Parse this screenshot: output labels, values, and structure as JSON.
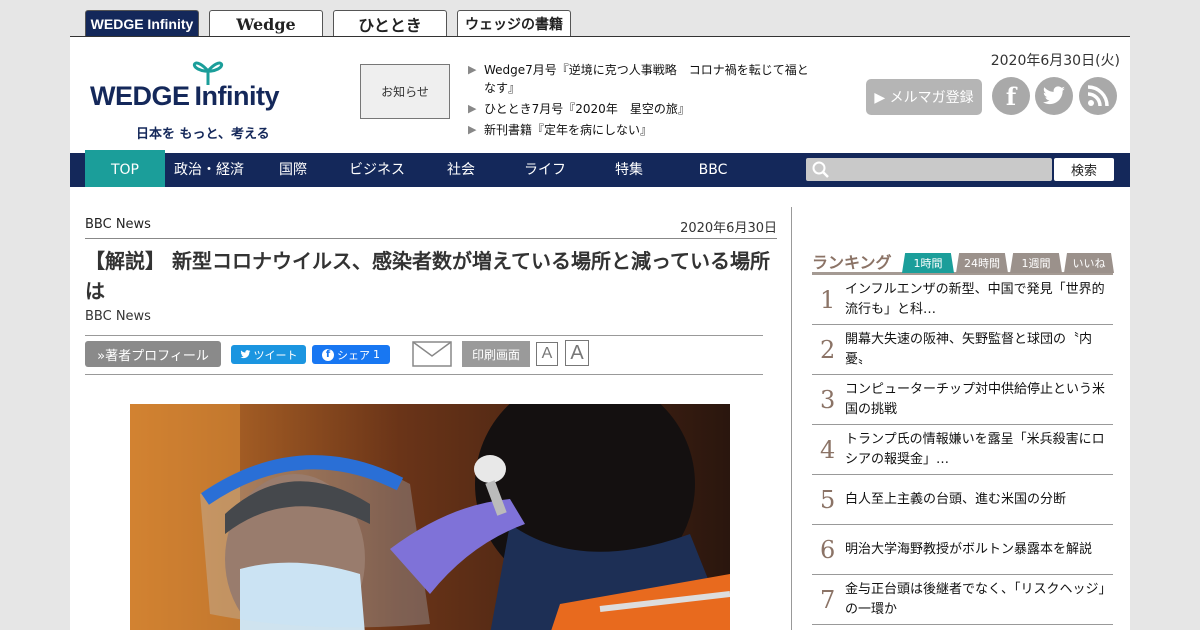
{
  "site_tabs": [
    "WEDGE Infinity",
    "Wedge",
    "ひととき",
    "ウェッジの書籍"
  ],
  "header": {
    "logo_left": "WEDGE",
    "logo_right": "Infinity",
    "logo_tagline": "日本を もっと、考える",
    "notice_label": "お知らせ",
    "news": [
      "Wedge7月号『逆境に克つ人事戦略　コロナ禍を転じて福となす』",
      "ひととき7月号『2020年　星空の旅』",
      "新刊書籍『定年を病にしない』"
    ],
    "date": "2020年6月30日(火)",
    "mail_label": "▶ メルマガ登録",
    "social": {
      "facebook": "f",
      "twitter": "t",
      "rss": "rss"
    }
  },
  "nav": {
    "items": [
      "TOP",
      "政治・経済",
      "国際",
      "ビジネス",
      "社会",
      "ライフ",
      "特集",
      "BBC"
    ],
    "search_button": "検索",
    "search_placeholder": ""
  },
  "article": {
    "source_top": "BBC News",
    "date": "2020年6月30日",
    "title": "【解説】 新型コロナウイルス、感染者数が増えている場所と減っている場所は",
    "byline": "BBC News",
    "profile_button": "»著者プロフィール",
    "tweet_label": "ツイート",
    "share_label": "シェア",
    "share_count": "1",
    "print_label": "印刷画面",
    "font_small": "A",
    "font_large": "A"
  },
  "ranking": {
    "title": "ランキング",
    "tabs": [
      "1時間",
      "24時間",
      "1週間",
      "いいね"
    ],
    "items": [
      {
        "num": "1",
        "text": "インフルエンザの新型、中国で発見「世界的流行も」と科…"
      },
      {
        "num": "2",
        "text": "開幕大失速の阪神、矢野監督と球団の〝内憂〟"
      },
      {
        "num": "3",
        "text": "コンピューターチップ対中供給停止という米国の挑戦"
      },
      {
        "num": "4",
        "text": "トランプ氏の情報嫌いを露呈「米兵殺害にロシアの報奨金」…"
      },
      {
        "num": "5",
        "text": "白人至上主義の台頭、進む米国の分断"
      },
      {
        "num": "6",
        "text": "明治大学海野教授がボルトン暴露本を解説"
      },
      {
        "num": "7",
        "text": "金与正台頭は後継者でなく、「リスクヘッジ」の一環か"
      }
    ]
  },
  "colors": {
    "navy": "#14285a",
    "teal": "#1b9e9a",
    "rank_brown": "#8b7366"
  }
}
